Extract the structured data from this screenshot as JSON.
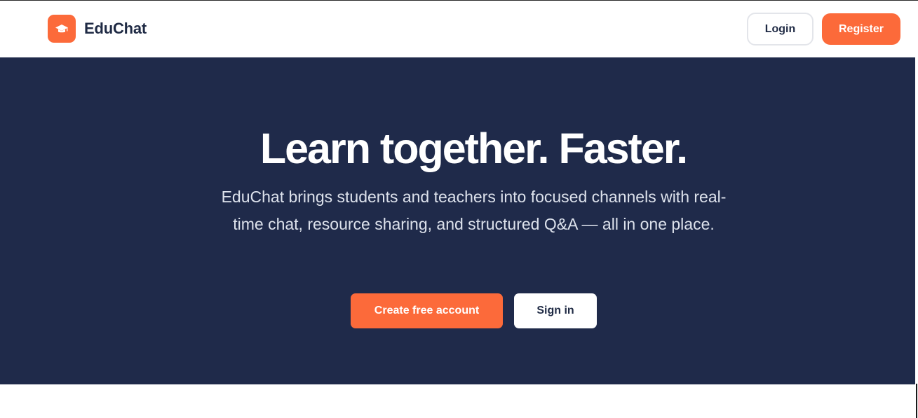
{
  "brand": {
    "name": "EduChat",
    "logo_icon": "graduation-cap-icon",
    "accent": "#fc6a3a"
  },
  "nav": {
    "login_label": "Login",
    "register_label": "Register"
  },
  "hero": {
    "title": "Learn together. Faster.",
    "subtitle": "EduChat brings students and teachers into focused channels with real-time chat, resource sharing, and structured Q&A — all in one place.",
    "primary_cta": "Create free account",
    "secondary_cta": "Sign in",
    "background": "#1f2a4a"
  }
}
